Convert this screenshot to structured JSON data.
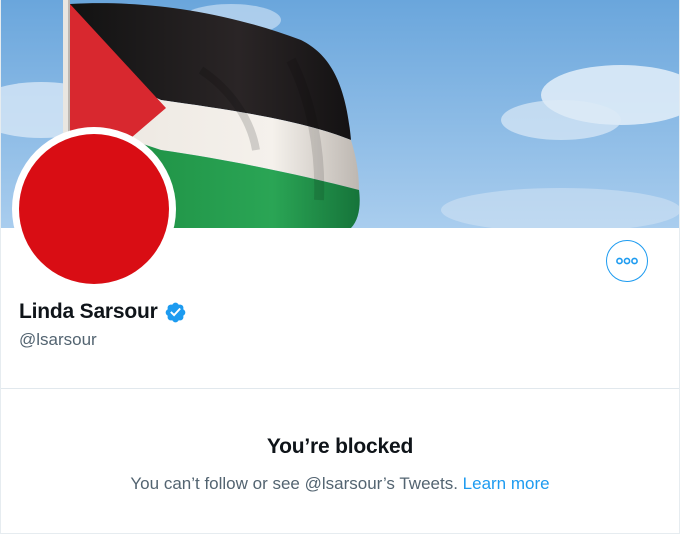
{
  "profile": {
    "display_name": "Linda Sarsour",
    "handle": "@lsarsour",
    "verified_icon": "verified-badge-icon",
    "avatar_color": "#d90d14"
  },
  "banner": {
    "description_icon": "flag-banner-image"
  },
  "actions": {
    "more_icon": "more-options-icon"
  },
  "blocked": {
    "title": "You’re blocked",
    "message": "You can’t follow or see @lsarsour’s Tweets.",
    "learn_more": "Learn more"
  },
  "colors": {
    "accent": "#1d9bf0",
    "text_primary": "#0f1419",
    "text_secondary": "#536471"
  }
}
